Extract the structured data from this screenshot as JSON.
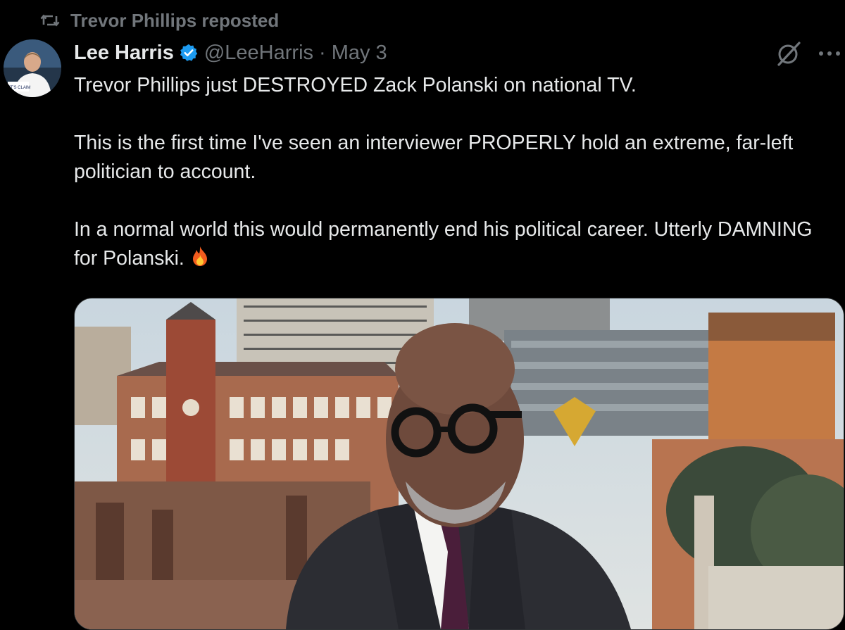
{
  "repost": {
    "text": "Trevor Phillips reposted",
    "icon": "repost-icon"
  },
  "author": {
    "display_name": "Lee Harris",
    "verified": true,
    "handle": "@LeeHarris",
    "separator": "·",
    "date": "May 3",
    "avatar_badge_text": "IT'S CLAIM"
  },
  "actions": {
    "grok_icon": "grok-icon",
    "more_label": "···"
  },
  "tweet": {
    "paragraphs": [
      "Trevor Phillips just DESTROYED Zack Polanski on national TV.",
      "This is the first time I've seen an interviewer PROPERLY hold an extreme, far-left politician to account.",
      "In a normal world this would permanently end his political career. Utterly DAMNING for Polanski."
    ],
    "emoji": "fire-emoji"
  },
  "media": {
    "type": "video-still",
    "description_icon": "interview-photo"
  },
  "colors": {
    "background": "#000000",
    "text": "#e7e9ea",
    "muted": "#71767b",
    "verified": "#1d9bf0"
  }
}
